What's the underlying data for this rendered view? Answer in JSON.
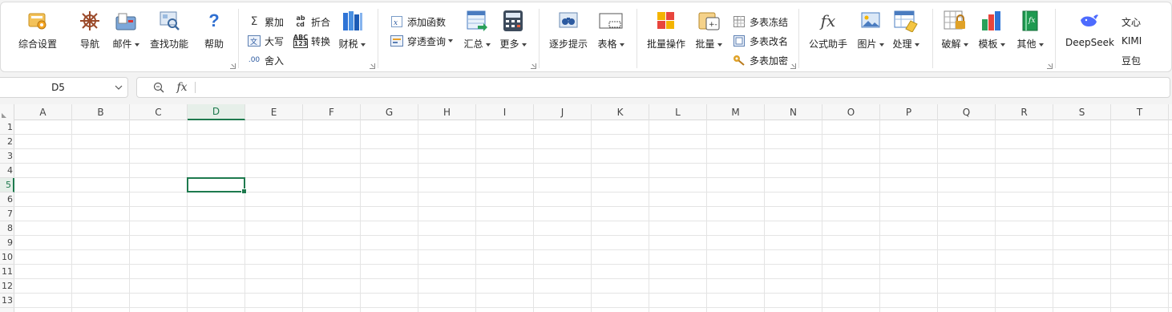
{
  "ribbon": {
    "g1": {
      "settings": "综合设置",
      "nav": "导航",
      "mail": "邮件",
      "find": "查找功能",
      "help": "帮助"
    },
    "g2": {
      "sum": "累加",
      "fold": "折合",
      "upper": "大写",
      "convert": "转换",
      "round": "舍入",
      "finance": "财税"
    },
    "g3": {
      "add_func": "添加函数",
      "drill": "穿透查询",
      "summary": "汇总",
      "more": "更多"
    },
    "g4": {
      "step_hint": "逐步提示",
      "table": "表格"
    },
    "g5": {
      "batch_op": "批量操作",
      "batch": "批量",
      "freeze": "多表冻结",
      "rename": "多表改名",
      "encrypt": "多表加密"
    },
    "g6": {
      "formula": "公式助手",
      "picture": "图片",
      "process": "处理"
    },
    "g7": {
      "crack": "破解",
      "template": "模板",
      "other": "其他"
    },
    "g8": {
      "deepseek": "DeepSeek",
      "wenxin": "文心",
      "kimi": "KIMI",
      "doubao": "豆包"
    }
  },
  "formula_bar": {
    "name_box": "D5",
    "fx": "fx",
    "formula": ""
  },
  "sheet": {
    "columns": [
      "A",
      "B",
      "C",
      "D",
      "E",
      "F",
      "G",
      "H",
      "I",
      "J",
      "K",
      "L",
      "M",
      "N",
      "O",
      "P",
      "Q",
      "R",
      "S",
      "T"
    ],
    "rows": [
      "1",
      "2",
      "3",
      "4",
      "5",
      "6",
      "7",
      "8",
      "9",
      "10",
      "11",
      "12",
      "13"
    ],
    "selected_col": "D",
    "selected_row": "5"
  },
  "colors": {
    "accent": "#1e7a4e",
    "grid": "#e4e4e4"
  }
}
